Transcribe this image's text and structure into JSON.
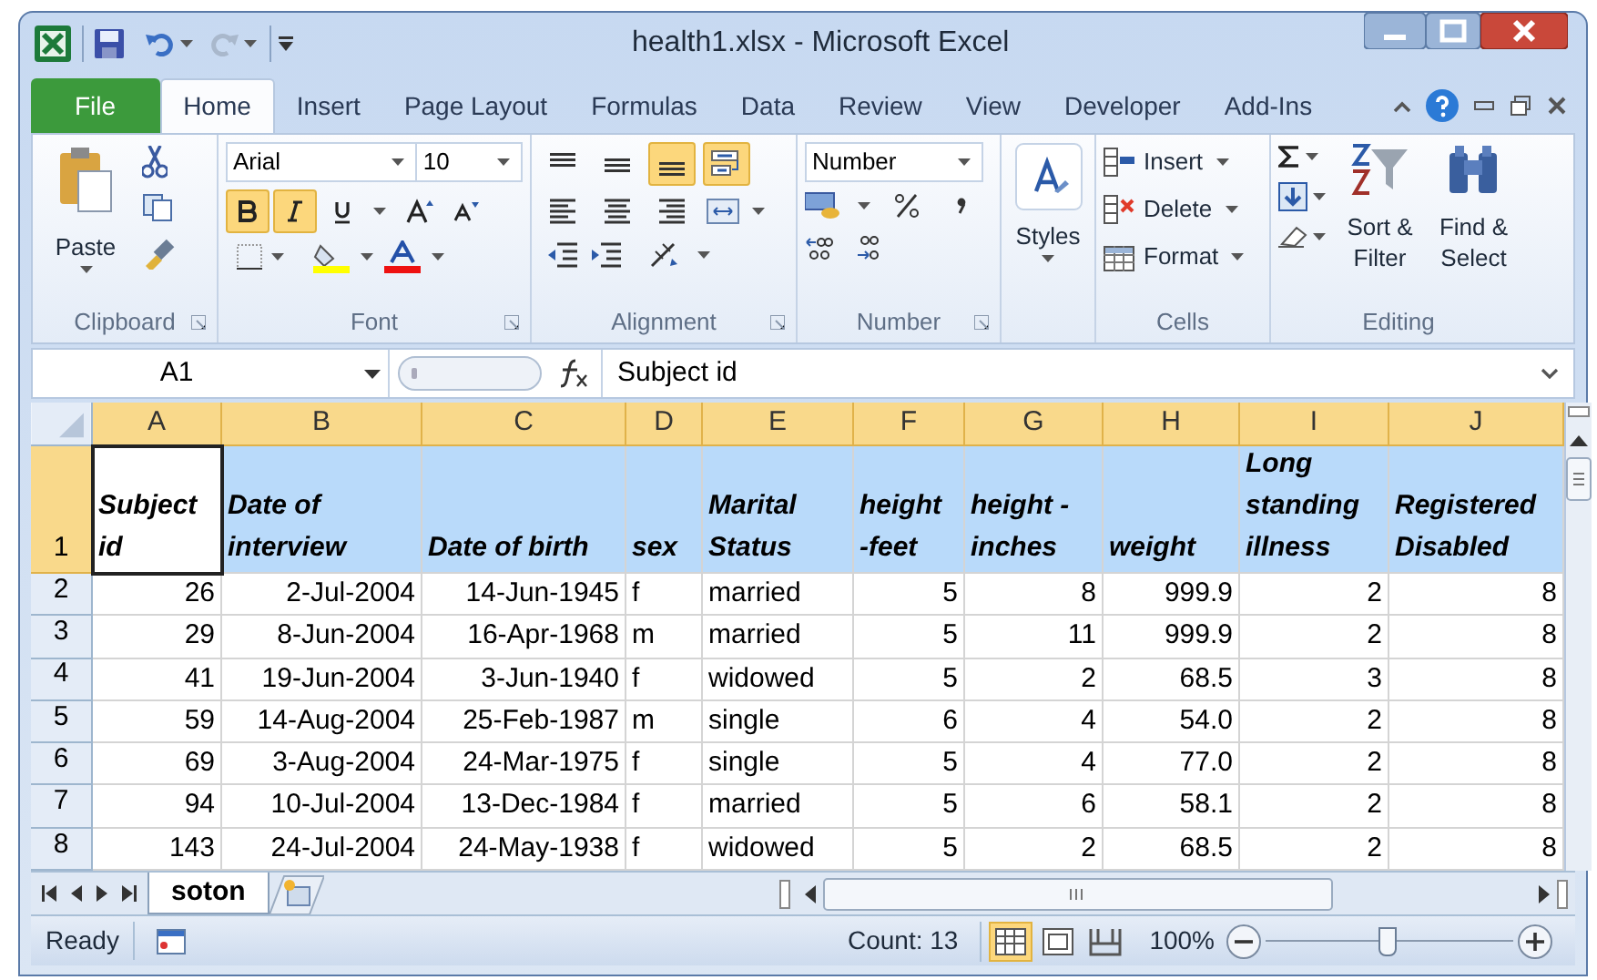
{
  "window": {
    "title": "health1.xlsx - Microsoft Excel"
  },
  "tabs": [
    {
      "label": "File",
      "kind": "file",
      "selected": false
    },
    {
      "label": "Home",
      "kind": "tab",
      "selected": true
    },
    {
      "label": "Insert",
      "kind": "tab",
      "selected": false
    },
    {
      "label": "Page Layout",
      "kind": "tab",
      "selected": false
    },
    {
      "label": "Formulas",
      "kind": "tab",
      "selected": false
    },
    {
      "label": "Data",
      "kind": "tab",
      "selected": false
    },
    {
      "label": "Review",
      "kind": "tab",
      "selected": false
    },
    {
      "label": "View",
      "kind": "tab",
      "selected": false
    },
    {
      "label": "Developer",
      "kind": "tab",
      "selected": false
    },
    {
      "label": "Add-Ins",
      "kind": "tab",
      "selected": false
    }
  ],
  "ribbon": {
    "clipboard": {
      "label": "Clipboard",
      "paste": "Paste"
    },
    "font": {
      "label": "Font",
      "name": "Arial",
      "size": "10",
      "bold": true,
      "italic": true,
      "underline": false
    },
    "alignment": {
      "label": "Alignment",
      "top_align": false,
      "middle_align": false,
      "bottom_align": true,
      "wrap_text": true
    },
    "number": {
      "label": "Number",
      "format": "Number"
    },
    "styles": {
      "label": "Styles"
    },
    "cells": {
      "label": "Cells",
      "buttons": [
        "Insert",
        "Delete",
        "Format"
      ]
    },
    "editing": {
      "label": "Editing",
      "sort": "Sort & Filter",
      "find": "Find & Select"
    }
  },
  "formula_bar": {
    "name_box": "A1",
    "formula": "Subject id"
  },
  "columns": [
    {
      "letter": "A",
      "kind": "number",
      "selected": true
    },
    {
      "letter": "B",
      "kind": "number",
      "selected": true
    },
    {
      "letter": "C",
      "kind": "number",
      "selected": true
    },
    {
      "letter": "D",
      "kind": "text",
      "selected": true
    },
    {
      "letter": "E",
      "kind": "text",
      "selected": true
    },
    {
      "letter": "F",
      "kind": "number",
      "selected": true
    },
    {
      "letter": "G",
      "kind": "number",
      "selected": true
    },
    {
      "letter": "H",
      "kind": "number",
      "selected": true
    },
    {
      "letter": "I",
      "kind": "number",
      "selected": true
    },
    {
      "letter": "J",
      "kind": "number",
      "selected": true
    }
  ],
  "header_row": {
    "number": "1",
    "selected": true,
    "cells": [
      {
        "text": "Subject id",
        "active": true
      },
      {
        "text": "Date of interview",
        "active": false
      },
      {
        "text": "Date of birth",
        "active": false
      },
      {
        "text": "sex",
        "active": false
      },
      {
        "text": "Marital Status",
        "active": false
      },
      {
        "text": "height -feet",
        "active": false
      },
      {
        "text": "height - inches",
        "active": false
      },
      {
        "text": "weight",
        "active": false
      },
      {
        "text": "Long standing illness",
        "active": false
      },
      {
        "text": "Registered Disabled",
        "active": false
      }
    ]
  },
  "rows": [
    {
      "number": "2",
      "selected": false,
      "cells": [
        "26",
        "2-Jul-2004",
        "14-Jun-1945",
        "f",
        "married",
        "5",
        "8",
        "999.9",
        "2",
        "8"
      ]
    },
    {
      "number": "3",
      "selected": false,
      "cells": [
        "29",
        "8-Jun-2004",
        "16-Apr-1968",
        "m",
        "married",
        "5",
        "11",
        "999.9",
        "2",
        "8"
      ]
    },
    {
      "number": "4",
      "selected": false,
      "cells": [
        "41",
        "19-Jun-2004",
        "3-Jun-1940",
        "f",
        "widowed",
        "5",
        "2",
        "68.5",
        "3",
        "8"
      ]
    },
    {
      "number": "5",
      "selected": false,
      "cells": [
        "59",
        "14-Aug-2004",
        "25-Feb-1987",
        "m",
        "single",
        "6",
        "4",
        "54.0",
        "2",
        "8"
      ]
    },
    {
      "number": "6",
      "selected": false,
      "cells": [
        "69",
        "3-Aug-2004",
        "24-Mar-1975",
        "f",
        "single",
        "5",
        "4",
        "77.0",
        "2",
        "8"
      ]
    },
    {
      "number": "7",
      "selected": false,
      "cells": [
        "94",
        "10-Jul-2004",
        "13-Dec-1984",
        "f",
        "married",
        "5",
        "6",
        "58.1",
        "2",
        "8"
      ]
    },
    {
      "number": "8",
      "selected": false,
      "cells": [
        "143",
        "24-Jul-2004",
        "24-May-1938",
        "f",
        "widowed",
        "5",
        "2",
        "68.5",
        "2",
        "8"
      ]
    }
  ],
  "sheet_tabs": [
    {
      "label": "soton",
      "selected": true
    }
  ],
  "status_bar": {
    "mode": "Ready",
    "count": "Count: 13",
    "zoom": "100%",
    "zoom_slider": {
      "level": 0.49
    },
    "views": [
      {
        "kind": "normal",
        "selected": true
      },
      {
        "kind": "page_layout",
        "selected": false
      },
      {
        "kind": "page_break",
        "selected": false
      }
    ]
  }
}
